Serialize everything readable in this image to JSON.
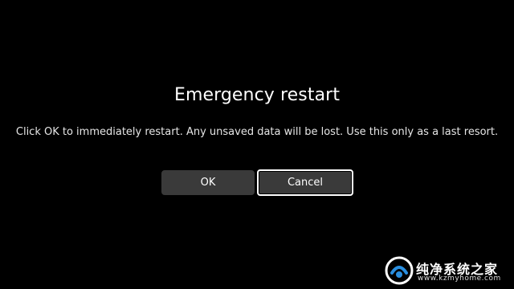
{
  "dialog": {
    "title": "Emergency restart",
    "message": "Click OK to immediately restart. Any unsaved data will be lost. Use this only as a last resort.",
    "buttons": {
      "ok_label": "OK",
      "cancel_label": "Cancel"
    },
    "focused_button": "cancel"
  },
  "watermark": {
    "brand_text": "纯净系统之家",
    "url_text": "www.kzmyhome.com",
    "logo_icon": "brand-logo-icon"
  },
  "colors": {
    "background": "#000000",
    "button_bg": "#3a3a3a",
    "focus_ring": "#ffffff",
    "text": "#ffffff"
  }
}
